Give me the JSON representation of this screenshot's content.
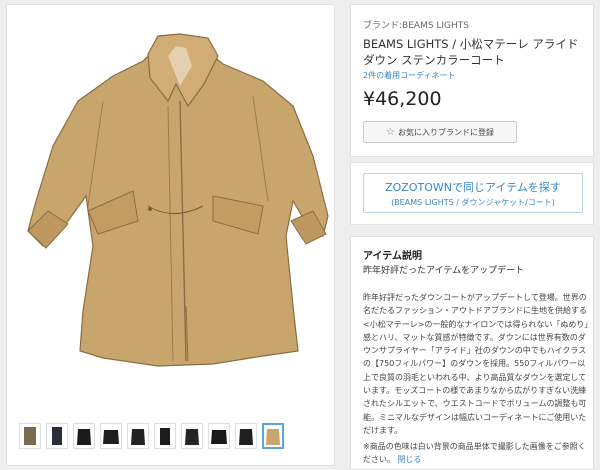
{
  "product": {
    "brand_line": "ブランド:BEAMS LIGHTS",
    "title": "BEAMS LIGHTS / 小松マテーレ アライド ダウン ステンカラーコート",
    "coordinate_link": "2件の着用コーディネート",
    "price": "¥46,200",
    "favorite_button_label": "お気に入りブランドに登録"
  },
  "zozotown": {
    "main_label": "ZOZOTOWNで同じアイテムを探す",
    "sub_label": "(BEAMS LIGHTS / ダウンジャケット/コート)"
  },
  "description": {
    "heading": "アイテム説明",
    "subheading": "昨年好評だったアイテムをアップデート",
    "body": "昨年好評だったダウンコートがアップデートして登場。世界の名だたるファッション・アウトドアブランドに生地を供給する<小松マテーレ>の一般的なナイロンでは得られない「ぬめり」感とハリ、マットな質感が特徴です。ダウンには世界有数のダウンサプライヤー「アライド」社のダウンの中でもハイクラスの【750フィルパワー】のダウンを採用。550フィルパワー以上で良質の羽毛といわれる中、より高品質なダウンを選定しています。モッズコートの様であまりなから広がりすぎない洗練されたシルエットで、ウエストコードでボリュームの調整も可能。ミニマルなデザインは幅広いコーディネートにご使用いただけます。",
    "note": "※商品の色味は白い背景の商品単体で撮影した画像をご参照ください。",
    "close_label": "閉じる"
  },
  "gallery": {
    "thumbnail_count": 10,
    "selected_index": 9
  },
  "colors": {
    "link_blue": "#3a87c6",
    "coat_beige": "#c9a56e"
  }
}
